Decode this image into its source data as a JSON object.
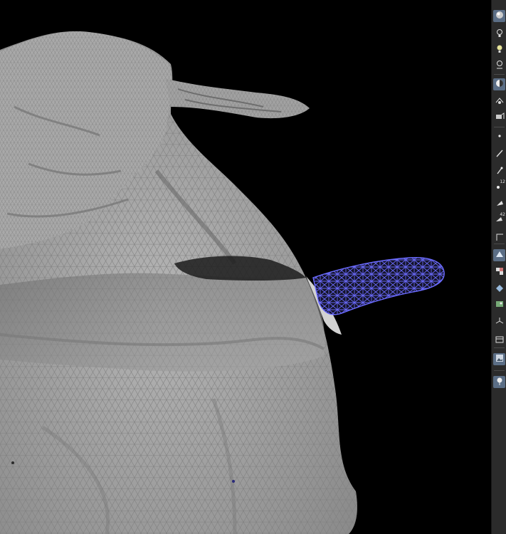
{
  "viewport": {
    "background": "#000000",
    "mesh_color": "#9c9c9c",
    "selection_color": "#5c5cff"
  },
  "toolbar": {
    "items": [
      {
        "icon": "shading-sphere-icon",
        "active": true
      },
      {
        "icon": "light-bulb-icon"
      },
      {
        "icon": "light-bulb-alt-icon"
      },
      {
        "icon": "point-light-icon"
      },
      {
        "icon": "display-mode-icon",
        "active": true
      },
      {
        "icon": "camera-tools-icon"
      },
      {
        "icon": "render-paint-icon"
      },
      {
        "icon": "vertex-icon"
      },
      {
        "icon": "edge-brush-icon"
      },
      {
        "icon": "pin-icon"
      },
      {
        "icon": "point-number-icon",
        "badge": "12"
      },
      {
        "icon": "face-brush-icon"
      },
      {
        "icon": "primitive-number-icon",
        "badge": "42"
      },
      {
        "icon": "bounding-box-icon"
      },
      {
        "icon": "triangle-display-icon",
        "active": true
      },
      {
        "icon": "checker-texture-icon"
      },
      {
        "icon": "normals-icon"
      },
      {
        "icon": "texture-uv-icon"
      },
      {
        "icon": "axis-icon"
      },
      {
        "icon": "layout-icon"
      },
      {
        "icon": "image-plane-icon",
        "active": true
      },
      {
        "icon": "target-lock-icon",
        "active": true
      }
    ]
  }
}
